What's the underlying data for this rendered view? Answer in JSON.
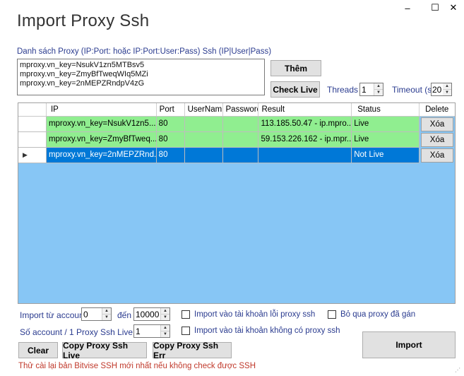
{
  "window": {
    "title": "Import Proxy Ssh",
    "minimize": "–",
    "maximize": "☐",
    "close": "✕"
  },
  "proxy_list": {
    "label": "Danh sách Proxy (IP:Port: hoặc IP:Port:User:Pass) Ssh (IP|User|Pass)",
    "lines": "mproxy.vn_key=NsukV1zn5MTBsv5\nmproxy.vn_key=ZmyBfTweqWIq5MZi\nmproxy.vn_key=2nMEPZRndpV4zG"
  },
  "buttons": {
    "add": "Thêm",
    "check_live": "Check Live",
    "clear": "Clear",
    "copy_live": "Copy Proxy Ssh Live",
    "copy_err": "Copy Proxy Ssh Err",
    "import": "Import"
  },
  "threads": {
    "label": "Threads",
    "value": "1"
  },
  "timeout": {
    "label": "Timeout (s)",
    "value": "20"
  },
  "table": {
    "columns": [
      "IP",
      "Port",
      "UserNam",
      "Password",
      "Result",
      "Status",
      "Delete"
    ],
    "rows": [
      {
        "ip": "mproxy.vn_key=NsukV1zn5...",
        "port": "80",
        "user": "",
        "password": "",
        "result": "113.185.50.47 - ip.mpro...",
        "status": "Live",
        "delete": "Xóa"
      },
      {
        "ip": "mproxy.vn_key=ZmyBfTweq...",
        "port": "80",
        "user": "",
        "password": "",
        "result": "59.153.226.162 - ip.mpr...",
        "status": "Live",
        "delete": "Xóa"
      },
      {
        "ip": "mproxy.vn_key=2nMEPZRnd...",
        "port": "80",
        "user": "",
        "password": "",
        "result": "",
        "status": "Not Live",
        "delete": "Xóa"
      }
    ]
  },
  "import_range": {
    "from_label": "Import từ account",
    "from_value": "0",
    "to_label": "đến",
    "to_value": "10000"
  },
  "per_proxy": {
    "label": "Số account / 1 Proxy Ssh Live",
    "value": "1"
  },
  "checkboxes": {
    "import_error": "Import vào tài khoản lỗi proxy ssh",
    "skip_assigned": "Bỏ qua proxy đã gán",
    "import_no_proxy": "Import vào tài khoản không có proxy ssh"
  },
  "note": "Thử cài lại bản Bitvise SSH mới nhất nếu không check được SSH",
  "colors": {
    "live_row": "#90ee90",
    "selected_row": "#0078d7",
    "grid_background": "#87c6f5",
    "note_text": "#c0392b"
  }
}
